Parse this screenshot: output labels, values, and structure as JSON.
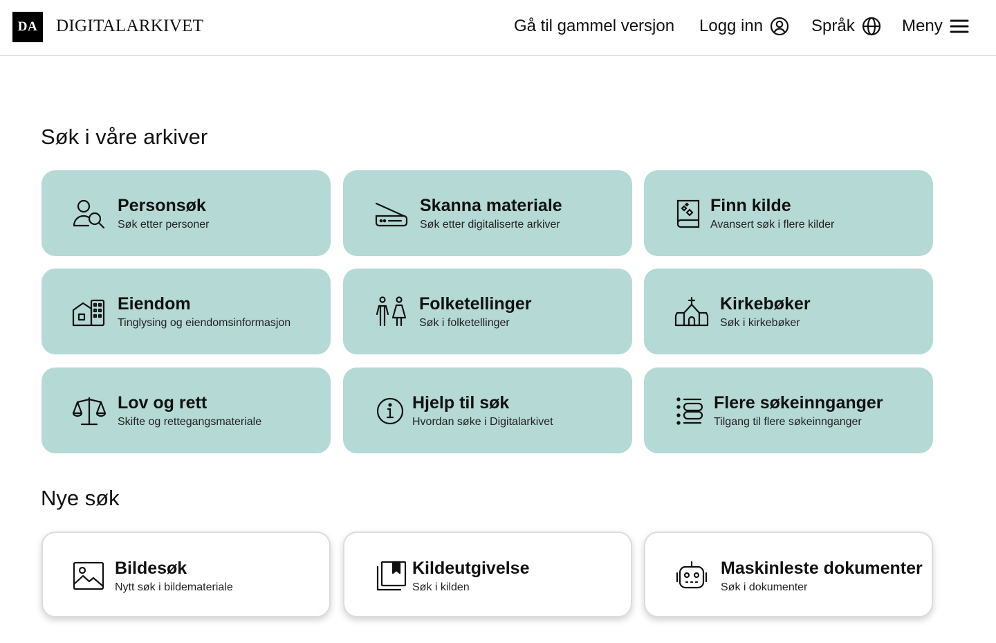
{
  "header": {
    "logo_mark": "DA",
    "logo_text": "DIGITALARKIVET",
    "old_version": "Gå til gammel versjon",
    "login": "Logg inn",
    "language": "Språk",
    "menu": "Meny"
  },
  "sections": {
    "search_title": "Søk i våre arkiver",
    "new_title": "Nye søk"
  },
  "cards": [
    {
      "title": "Personsøk",
      "sub": "Søk etter personer",
      "icon": "person-search-icon"
    },
    {
      "title": "Skanna materiale",
      "sub": "Søk etter digitaliserte arkiver",
      "icon": "scanner-icon"
    },
    {
      "title": "Finn kilde",
      "sub": "Avansert søk i flere kilder",
      "icon": "book-search-icon"
    },
    {
      "title": "Eiendom",
      "sub": "Tinglysing og eiendomsinformasjon",
      "icon": "property-icon"
    },
    {
      "title": "Folketellinger",
      "sub": "Søk i folketellinger",
      "icon": "people-icon"
    },
    {
      "title": "Kirkebøker",
      "sub": "Søk i kirkebøker",
      "icon": "church-icon"
    },
    {
      "title": "Lov og rett",
      "sub": "Skifte og rettegangsmateriale",
      "icon": "scales-icon"
    },
    {
      "title": "Hjelp til søk",
      "sub": "Hvordan søke i Digitalarkivet",
      "icon": "info-icon"
    },
    {
      "title": "Flere søkeinnganger",
      "sub": "Tilgang til flere søkeinnganger",
      "icon": "list-icon"
    }
  ],
  "new_cards": [
    {
      "title": "Bildesøk",
      "sub": "Nytt søk i bildemateriale",
      "icon": "image-icon"
    },
    {
      "title": "Kildeutgivelse",
      "sub": "Søk i kilden",
      "icon": "publication-icon"
    },
    {
      "title": "Maskinleste dokumenter",
      "sub": "Søk i dokumenter",
      "icon": "robot-icon"
    }
  ],
  "colors": {
    "card_teal": "#b5d9d5",
    "card_white": "#ffffff"
  }
}
